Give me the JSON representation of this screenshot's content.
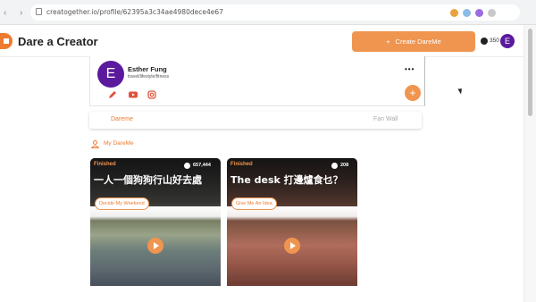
{
  "browser": {
    "url": "creatogether.io/profile/62395a3c34ae4980dece4e67"
  },
  "header": {
    "app_title": "Dare a Creator",
    "create_button": "Create DareMe",
    "coin_count": "350",
    "avatar_letter": "E"
  },
  "profile": {
    "avatar_letter": "E",
    "name": "Esther Fung",
    "category": "travel/lifestyle/fitness",
    "more": "•••",
    "add": "+"
  },
  "tabs": [
    {
      "label": "Dareme",
      "active": true
    },
    {
      "label": "Fan Wall",
      "active": false
    }
  ],
  "section": {
    "title": "My DareMe"
  },
  "cards": [
    {
      "status": "Finished",
      "count": "657,444",
      "title": "一人一個狗狗行山好去處",
      "tag": "Decide My Weekend"
    },
    {
      "status": "Finished",
      "count": "208",
      "title": "The desk 打邊爐食乜？",
      "tag": "Give Me An Idea"
    }
  ],
  "colors": {
    "accent": "#f0954f",
    "accent_text": "#ee7b30",
    "avatar": "#5b1a9e"
  }
}
